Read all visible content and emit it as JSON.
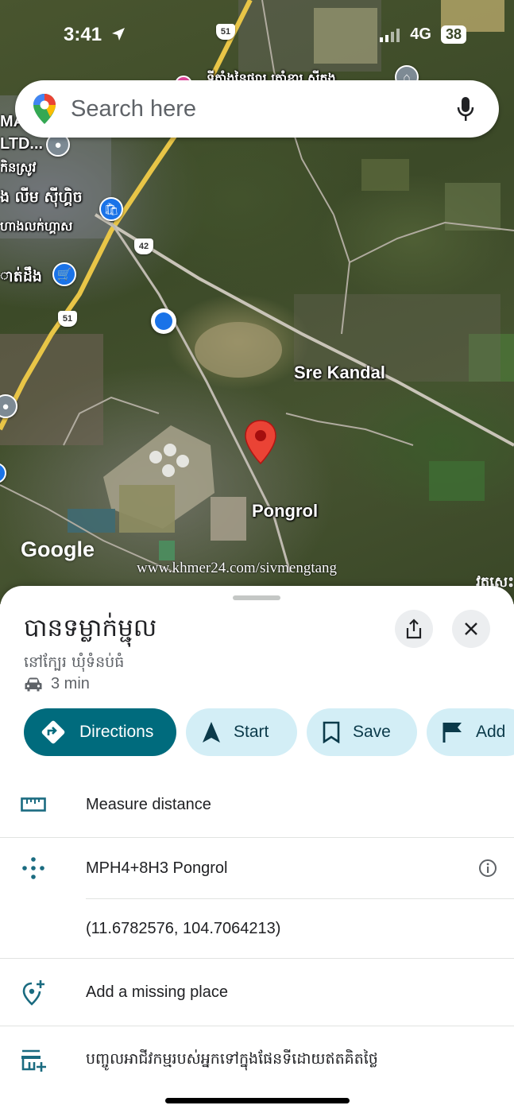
{
  "status_bar": {
    "time": "3:41",
    "network": "4G",
    "battery": "38"
  },
  "search": {
    "placeholder": "Search here"
  },
  "map": {
    "labels": {
      "sre_kandal": "Sre Kandal",
      "pongrol": "Pongrol",
      "top_khmer": "ទីតាំងនៃផ្សារ ត្រាំខ្នារ ស្វីតុង",
      "mal": "MAL",
      "ltd": "LTD...",
      "left1": "កិនស្រូវ",
      "left2": "ង លីម ស៊ីហ្គិច",
      "left3": "ហាងលក់ហ្គាស",
      "left4": "ាត់ដឹង",
      "edge": "វត្តសេះ"
    },
    "road_shields": {
      "r51_top": "51",
      "r42": "42",
      "r51_left": "51"
    },
    "google": "Google",
    "watermark": "www.khmer24.com/sivmengtang"
  },
  "place": {
    "title": "បានទម្លាក់ម្ជុល",
    "subtitle": "នៅក្បែរ ឃុំទំនប់ធំ",
    "drive_time": "3 min"
  },
  "actions": {
    "directions": "Directions",
    "start": "Start",
    "save": "Save",
    "add": "Add"
  },
  "details": {
    "measure": "Measure distance",
    "plus_code": "MPH4+8H3 Pongrol",
    "coordinates": "(11.6782576, 104.7064213)",
    "add_missing": "Add a missing place",
    "add_business": "បញ្ចូលអាជីវកម្មរបស់អ្នកទៅក្នុងផែនទីដោយឥតគិតថ្លៃ"
  },
  "colors": {
    "primary_teal": "#006b7d",
    "chip_bg": "#d3eef6",
    "icon_teal": "#1a6b80",
    "pin_red": "#ea4335",
    "location_blue": "#1a73e8"
  }
}
